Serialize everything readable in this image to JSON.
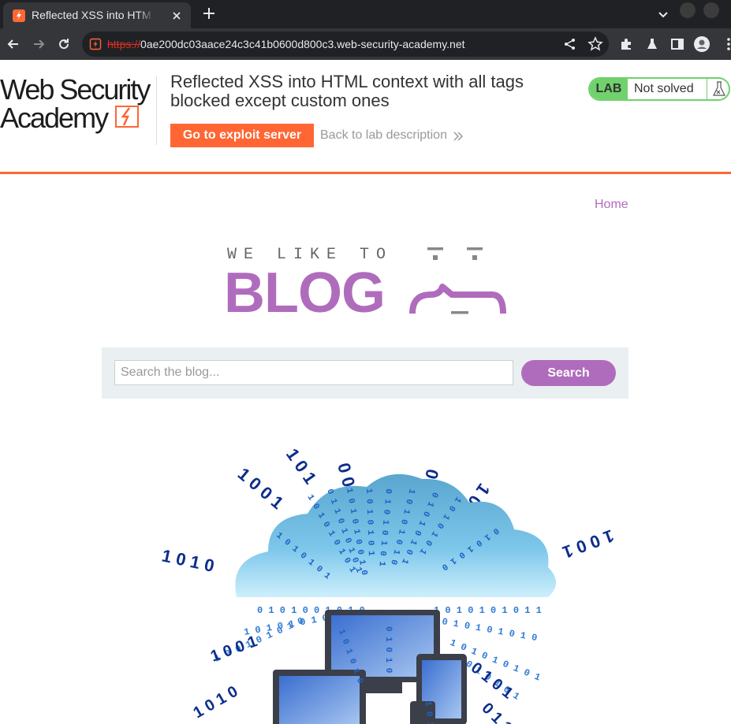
{
  "browser": {
    "tab_title": "Reflected XSS into HTML context with all tags blocked except custom ones",
    "url_scheme": "https://",
    "url_rest": "0ae200dc03aace24c3c41b0600d800c3.web-security-academy.net"
  },
  "header": {
    "logo_line1": "Web Security",
    "logo_line2": "Academy",
    "lab_title": "Reflected XSS into HTML context with all tags blocked except custom ones",
    "exploit_button": "Go to exploit server",
    "back_link": "Back to lab description",
    "status_tag": "LAB",
    "status_text": "Not solved"
  },
  "blog": {
    "nav_home": "Home",
    "banner_tagline": "WE LIKE TO",
    "banner_word": "BLOG",
    "search_placeholder": "Search the blog...",
    "search_button": "Search"
  },
  "colors": {
    "accent_orange": "#ff6633",
    "blog_purple": "#b06cbc",
    "status_green": "#70d16d",
    "search_panel": "#eaeff2"
  }
}
